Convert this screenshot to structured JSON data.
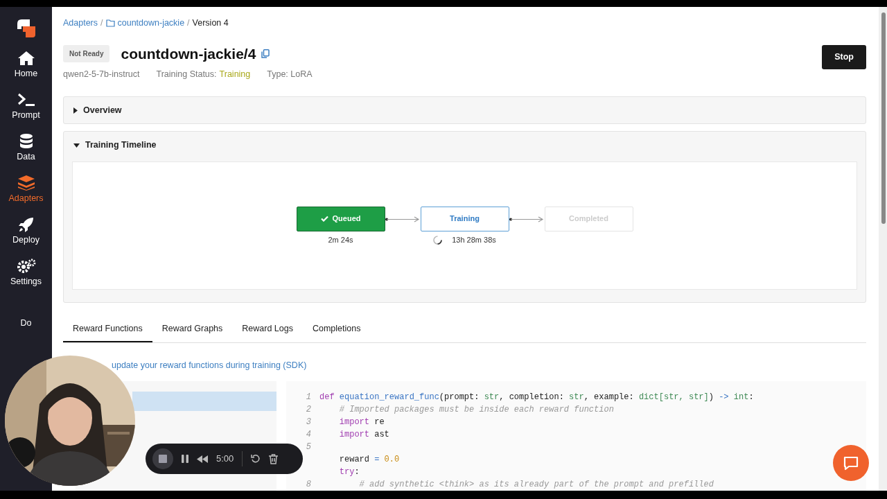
{
  "sidebar": {
    "items": [
      {
        "label": "Home",
        "selected": false
      },
      {
        "label": "Prompt",
        "selected": false
      },
      {
        "label": "Data",
        "selected": false
      },
      {
        "label": "Adapters",
        "selected": true
      },
      {
        "label": "Deploy",
        "selected": false
      },
      {
        "label": "Settings",
        "selected": false
      },
      {
        "label": "Do",
        "selected": false
      }
    ]
  },
  "breadcrumb": [
    {
      "label": "Adapters",
      "kind": "link"
    },
    {
      "label": "/",
      "kind": "separator"
    },
    {
      "label": "countdown-jackie",
      "kind": "folder"
    },
    {
      "label": "/",
      "kind": "separator"
    },
    {
      "label": "Version 4",
      "kind": "current"
    }
  ],
  "header": {
    "badge": "Not Ready",
    "title": "countdown-jackie/4",
    "base_model": "qwen2-5-7b-instruct",
    "status_label": "Training Status:",
    "status_value": "Training",
    "type": "Type: LoRA",
    "button": "Stop"
  },
  "sections": [
    {
      "title": "Overview",
      "expanded": false
    },
    {
      "title": "Training Timeline",
      "expanded": true
    }
  ],
  "timeline": [
    {
      "label": "Queued",
      "kind": "done",
      "duration": "2m 24s"
    },
    {
      "label": "Training",
      "kind": "active",
      "duration": "13h 28m 38s"
    },
    {
      "label": "Completed",
      "kind": "pending"
    }
  ],
  "tabs": [
    {
      "label": "Reward Functions",
      "selected": true
    },
    {
      "label": "Reward Graphs",
      "selected": false
    },
    {
      "label": "Reward Logs",
      "selected": false
    },
    {
      "label": "Completions",
      "selected": false
    }
  ],
  "help_link": "update your reward functions during training (SDK)",
  "function_list": [
    {
      "selected": true
    }
  ],
  "code": [
    {
      "number": "1",
      "tokens": [
        {
          "kind": "keyword",
          "text": "def "
        },
        {
          "kind": "function",
          "text": "equation_reward_func"
        },
        {
          "kind": "plain",
          "text": "(prompt: "
        },
        {
          "kind": "type",
          "text": "str"
        },
        {
          "kind": "plain",
          "text": ", completion: "
        },
        {
          "kind": "type",
          "text": "str"
        },
        {
          "kind": "plain",
          "text": ", example: "
        },
        {
          "kind": "type",
          "text": "dict[str, str]"
        },
        {
          "kind": "plain",
          "text": ") "
        },
        {
          "kind": "operator",
          "text": "->"
        },
        {
          "kind": "type",
          "text": " int"
        },
        {
          "kind": "plain",
          "text": ":"
        }
      ]
    },
    {
      "number": "2",
      "tokens": [
        {
          "kind": "comment",
          "text": "    # Imported packages must be inside each reward function"
        }
      ]
    },
    {
      "number": "3",
      "tokens": [
        {
          "kind": "keyword",
          "text": "    import"
        },
        {
          "kind": "plain",
          "text": " re"
        }
      ]
    },
    {
      "number": "4",
      "tokens": [
        {
          "kind": "keyword",
          "text": "    import"
        },
        {
          "kind": "plain",
          "text": " ast"
        }
      ]
    },
    {
      "number": "5"
    },
    {
      "tokens": [
        {
          "kind": "plain",
          "text": "    reward "
        },
        {
          "kind": "operator",
          "text": "="
        },
        {
          "kind": "number",
          "text": " 0.0"
        }
      ]
    },
    {
      "tokens": [
        {
          "kind": "keyword",
          "text": "    try"
        },
        {
          "kind": "plain",
          "text": ":"
        }
      ]
    },
    {
      "number": "8",
      "tokens": [
        {
          "kind": "comment",
          "text": "        # add synthetic <think> as its already part of the prompt and prefilled"
        }
      ]
    }
  ],
  "recorder": {
    "time": "5:00"
  }
}
